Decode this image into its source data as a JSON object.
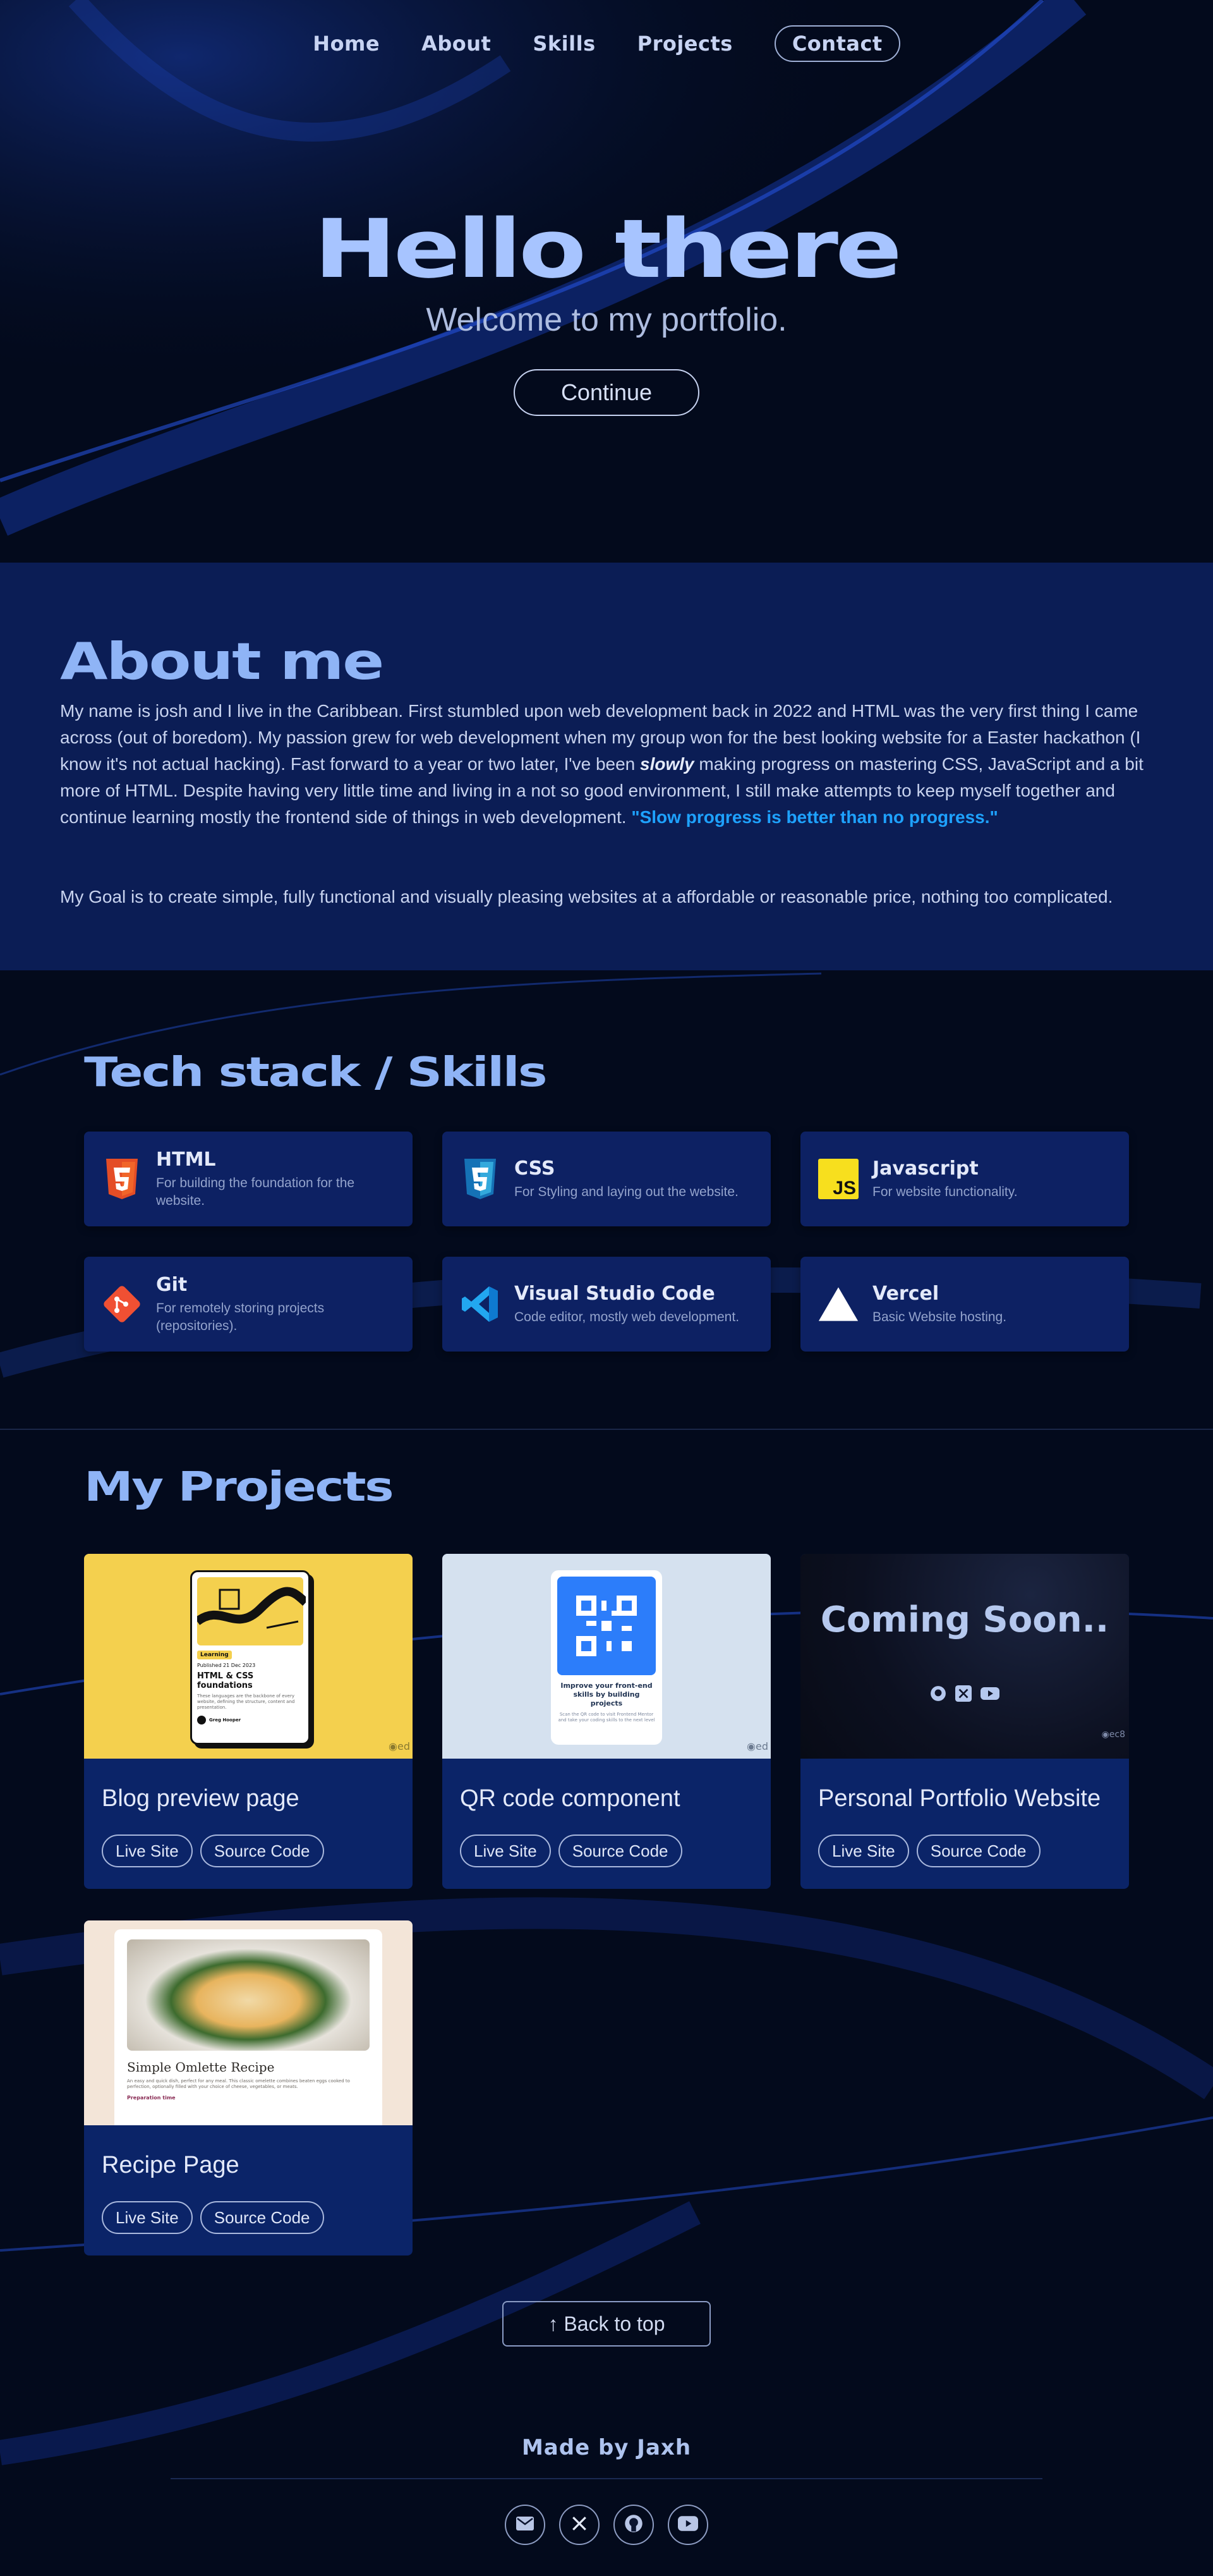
{
  "nav": {
    "home": "Home",
    "about": "About",
    "skills": "Skills",
    "projects": "Projects",
    "contact": "Contact"
  },
  "hero": {
    "title": "Hello there",
    "subtitle": "Welcome to my portfolio.",
    "cta": "Continue"
  },
  "about": {
    "title": "About me",
    "p1_a": "My name is josh and I live in the Caribbean. First stumbled upon web development back in 2022 and HTML was the very first thing I came across (out of boredom). My passion grew for web development when my group won for the best looking website for a Easter hackathon (I know it's not actual hacking). Fast forward to a year or two later, I've been ",
    "p1_em": "slowly",
    "p1_b": " making progress on mastering CSS, JavaScript and a bit more of HTML. Despite having very little time and living in a not so good environment, I still make attempts to keep myself together and continue learning mostly the frontend side of things in web development. ",
    "quote": "\"Slow progress is better than no progress.\"",
    "goal": "My Goal is to create simple, fully functional and visually pleasing websites at a affordable or reasonable price, nothing too complicated."
  },
  "skills": {
    "title": "Tech stack / Skills",
    "items": [
      {
        "name": "HTML",
        "desc": "For building the foundation for the website.",
        "icon": "html5-icon"
      },
      {
        "name": "CSS",
        "desc": "For Styling and laying out the website.",
        "icon": "css3-icon"
      },
      {
        "name": "Javascript",
        "desc": "For website functionality.",
        "icon": "javascript-icon"
      },
      {
        "name": "Git",
        "desc": "For remotely storing projects (repositories).",
        "icon": "git-icon"
      },
      {
        "name": "Visual Studio Code",
        "desc": "Code editor, mostly web development.",
        "icon": "vscode-icon"
      },
      {
        "name": "Vercel",
        "desc": "Basic Website hosting.",
        "icon": "vercel-icon"
      }
    ]
  },
  "projects": {
    "title": "My Projects",
    "live_label": "Live Site",
    "source_label": "Source Code",
    "items": [
      {
        "title": "Blog preview page",
        "thumb": {
          "tag": "Learning",
          "date": "Published 21 Dec 2023",
          "heading": "HTML & CSS foundations",
          "text": "These languages are the backbone of every website, defining the structure, content and presentation.",
          "author": "Greg Hooper",
          "brand": "ed"
        }
      },
      {
        "title": "QR code component",
        "thumb": {
          "heading": "Improve your front-end skills by building projects",
          "text": "Scan the QR code to visit Frontend Mentor and take your coding skills to the next level",
          "brand": "ed"
        }
      },
      {
        "title": "Personal Portfolio Website",
        "thumb": {
          "coming": "Coming Soon..",
          "brand": "ec8"
        }
      },
      {
        "title": "Recipe Page",
        "thumb": {
          "heading": "Simple Omlette Recipe",
          "text": "An easy and quick dish, perfect for any meal. This classic omelette combines beaten eggs cooked to perfection, optionally filled with your choice of cheese, vegetables, or meats.",
          "section": "Preparation time"
        }
      }
    ]
  },
  "back_to_top": "↑ Back to top",
  "footer": {
    "made_by": "Made by Jaxh",
    "socials": [
      "mail-icon",
      "x-icon",
      "github-icon",
      "youtube-icon"
    ]
  }
}
